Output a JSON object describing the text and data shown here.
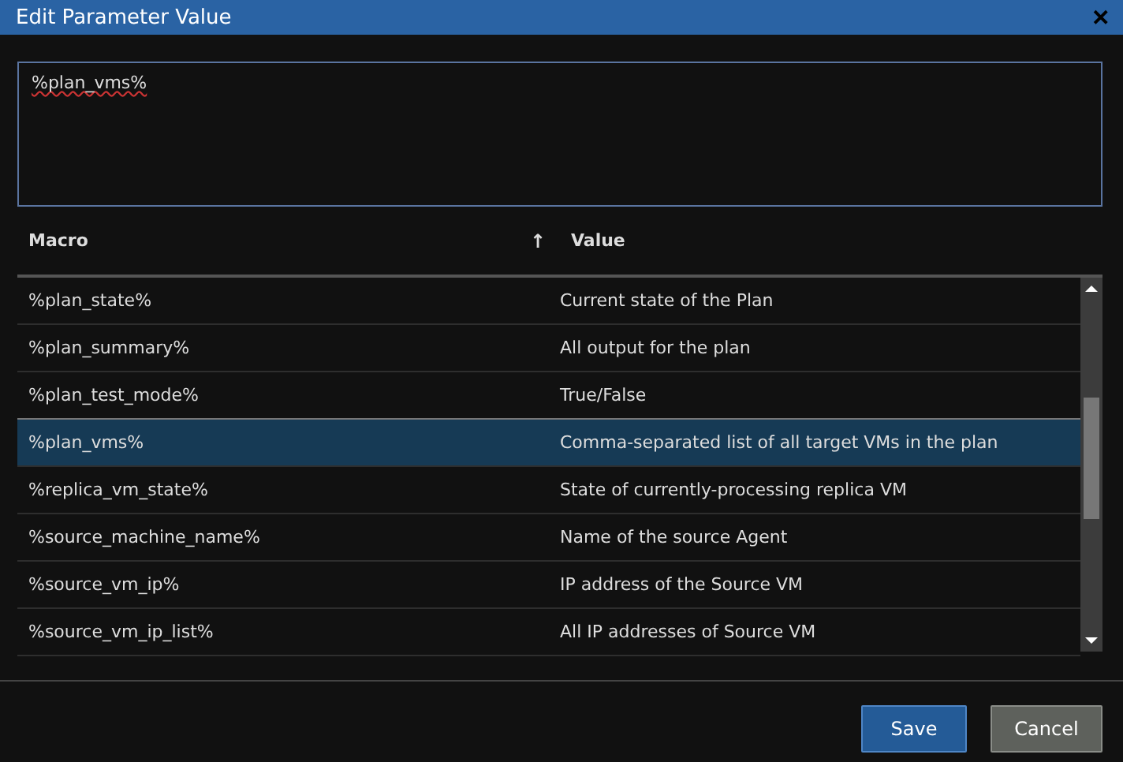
{
  "window": {
    "title": "Edit Parameter Value",
    "close": "✕"
  },
  "editor": {
    "value": "%plan_vms%"
  },
  "table": {
    "columns": [
      {
        "label": "Macro",
        "sort": "↑"
      },
      {
        "label": "Value"
      }
    ],
    "rows": [
      {
        "macro": "%plan_state%",
        "value": "Current state of the Plan",
        "selected": false
      },
      {
        "macro": "%plan_summary%",
        "value": "All output for the plan",
        "selected": false
      },
      {
        "macro": "%plan_test_mode%",
        "value": "True/False",
        "selected": false
      },
      {
        "macro": "%plan_vms%",
        "value": "Comma-separated list of all target VMs in the plan",
        "selected": true
      },
      {
        "macro": "%replica_vm_state%",
        "value": "State of currently-processing replica VM",
        "selected": false
      },
      {
        "macro": "%source_machine_name%",
        "value": "Name of the source Agent",
        "selected": false
      },
      {
        "macro": "%source_vm_ip%",
        "value": "IP address of the Source VM",
        "selected": false
      },
      {
        "macro": "%source_vm_ip_list%",
        "value": "All IP addresses of Source VM",
        "selected": false
      }
    ]
  },
  "buttons": [
    {
      "label": "Save",
      "kind": "primary"
    },
    {
      "label": "Cancel",
      "kind": "secondary"
    }
  ]
}
